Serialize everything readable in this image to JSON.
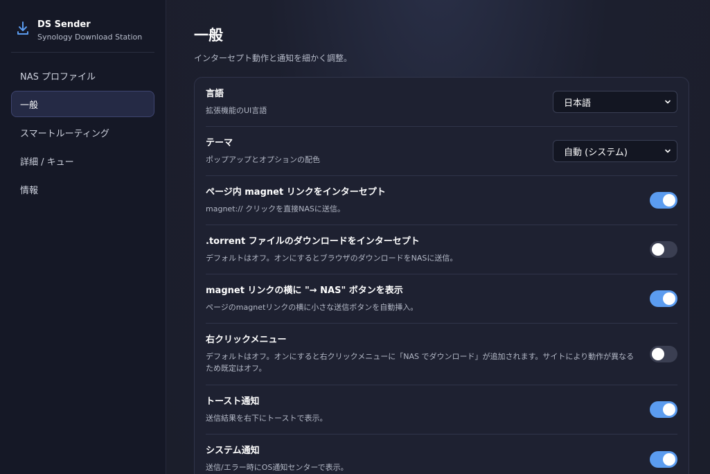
{
  "brand": {
    "name": "DS Sender",
    "subtitle": "Synology Download Station"
  },
  "nav": [
    {
      "label": "NAS プロファイル",
      "active": false
    },
    {
      "label": "一般",
      "active": true
    },
    {
      "label": "スマートルーティング",
      "active": false
    },
    {
      "label": "詳細 / キュー",
      "active": false
    },
    {
      "label": "情報",
      "active": false
    }
  ],
  "page": {
    "title": "一般",
    "subtitle": "インターセプト動作と通知を細かく調整。"
  },
  "settings": {
    "language": {
      "title": "言語",
      "desc": "拡張機能のUI言語",
      "value": "日本語"
    },
    "theme": {
      "title": "テーマ",
      "desc": "ポップアップとオプションの配色",
      "value": "自動 (システム)"
    },
    "magnet_intercept": {
      "title": "ページ内 magnet リンクをインターセプト",
      "desc": "magnet:// クリックを直接NASに送信。",
      "enabled": true
    },
    "torrent_intercept": {
      "title": ".torrent ファイルのダウンロードをインターセプト",
      "desc": "デフォルトはオフ。オンにするとブラウザのダウンロードをNASに送信。",
      "enabled": false
    },
    "magnet_button": {
      "title": "magnet リンクの横に \"→ NAS\" ボタンを表示",
      "desc": "ページのmagnetリンクの横に小さな送信ボタンを自動挿入。",
      "enabled": true
    },
    "context_menu": {
      "title": "右クリックメニュー",
      "desc": "デフォルトはオフ。オンにすると右クリックメニューに「NAS でダウンロード」が追加されます。サイトにより動作が異なるため既定はオフ。",
      "enabled": false
    },
    "toast": {
      "title": "トースト通知",
      "desc": "送信結果を右下にトーストで表示。",
      "enabled": true
    },
    "system_notify": {
      "title": "システム通知",
      "desc": "送信/エラー時にOS通知センターで表示。",
      "enabled": true
    }
  },
  "colors": {
    "accent": "#5b9cf0",
    "toggle_off": "#3b3f52",
    "sidebar_bg": "#151826",
    "card_bg": "#1e2131"
  }
}
